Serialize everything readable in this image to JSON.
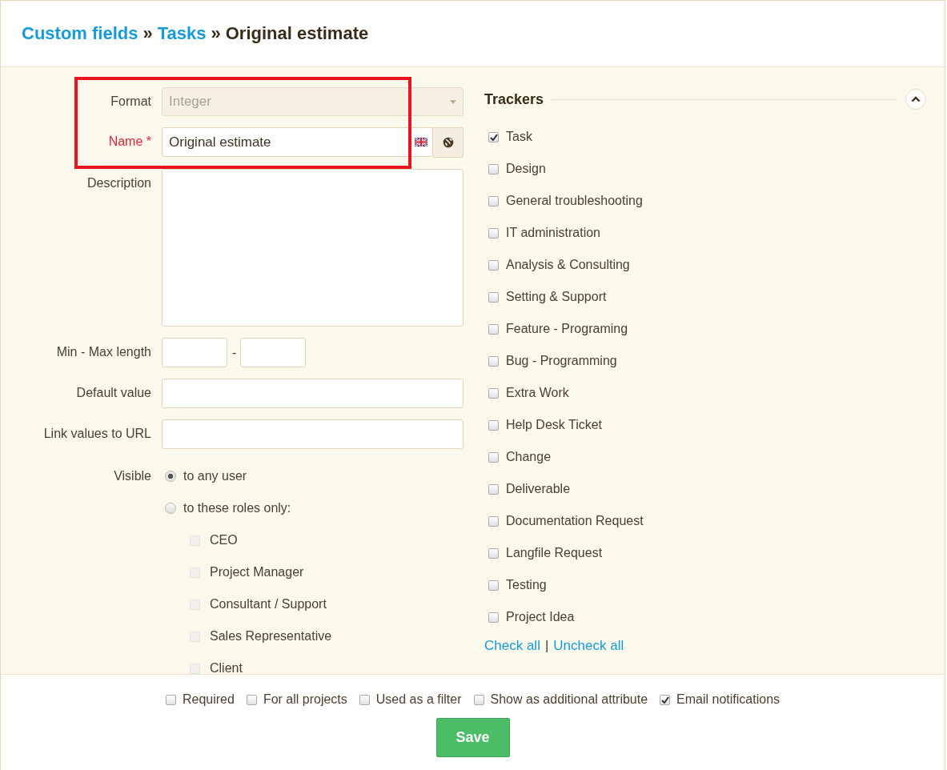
{
  "breadcrumb": [
    {
      "kind": "link",
      "label": "Custom fields"
    },
    {
      "kind": "separator",
      "label": "»"
    },
    {
      "kind": "link",
      "label": "Tasks"
    },
    {
      "kind": "separator",
      "label": "»"
    },
    {
      "kind": "current",
      "label": "Original estimate"
    }
  ],
  "format": {
    "label": "Format",
    "value": "Integer",
    "disabled": true
  },
  "name": {
    "label": "Name",
    "required": true,
    "required_mark": "*",
    "value": "Original estimate"
  },
  "description": {
    "label": "Description"
  },
  "length": {
    "label": "Min - Max length",
    "separator": "-"
  },
  "default_value": {
    "label": "Default value"
  },
  "link_url": {
    "label": "Link values to URL"
  },
  "visible": {
    "label": "Visible",
    "options": [
      {
        "label": "to any user",
        "selected": true
      },
      {
        "label": "to these roles only:",
        "selected": false
      }
    ],
    "roles": [
      {
        "label": "CEO",
        "checked": false,
        "disabled": true
      },
      {
        "label": "Project Manager",
        "checked": false,
        "disabled": true
      },
      {
        "label": "Consultant / Support",
        "checked": false,
        "disabled": true
      },
      {
        "label": "Sales Representative",
        "checked": false,
        "disabled": true
      },
      {
        "label": "Client",
        "checked": false,
        "disabled": true
      }
    ]
  },
  "trackers": {
    "title": "Trackers",
    "expanded": true,
    "items": [
      {
        "label": "Task",
        "checked": true
      },
      {
        "label": "Design",
        "checked": false
      },
      {
        "label": "General troubleshooting",
        "checked": false
      },
      {
        "label": "IT administration",
        "checked": false
      },
      {
        "label": "Analysis & Consulting",
        "checked": false
      },
      {
        "label": "Setting & Support",
        "checked": false
      },
      {
        "label": "Feature - Programing",
        "checked": false
      },
      {
        "label": "Bug - Programming",
        "checked": false
      },
      {
        "label": "Extra Work",
        "checked": false
      },
      {
        "label": "Help Desk Ticket",
        "checked": false
      },
      {
        "label": "Change",
        "checked": false
      },
      {
        "label": "Deliverable",
        "checked": false
      },
      {
        "label": "Documentation Request",
        "checked": false
      },
      {
        "label": "Langfile Request",
        "checked": false
      },
      {
        "label": "Testing",
        "checked": false
      },
      {
        "label": "Project Idea",
        "checked": false
      }
    ],
    "check_all": "Check all",
    "separator": "|",
    "uncheck_all": "Uncheck all"
  },
  "options": [
    {
      "label": "Required",
      "checked": false
    },
    {
      "label": "For all projects",
      "checked": false
    },
    {
      "label": "Used as a filter",
      "checked": false
    },
    {
      "label": "Show as additional attribute",
      "checked": false
    },
    {
      "label": "Email notifications",
      "checked": true
    }
  ],
  "save_button": "Save"
}
